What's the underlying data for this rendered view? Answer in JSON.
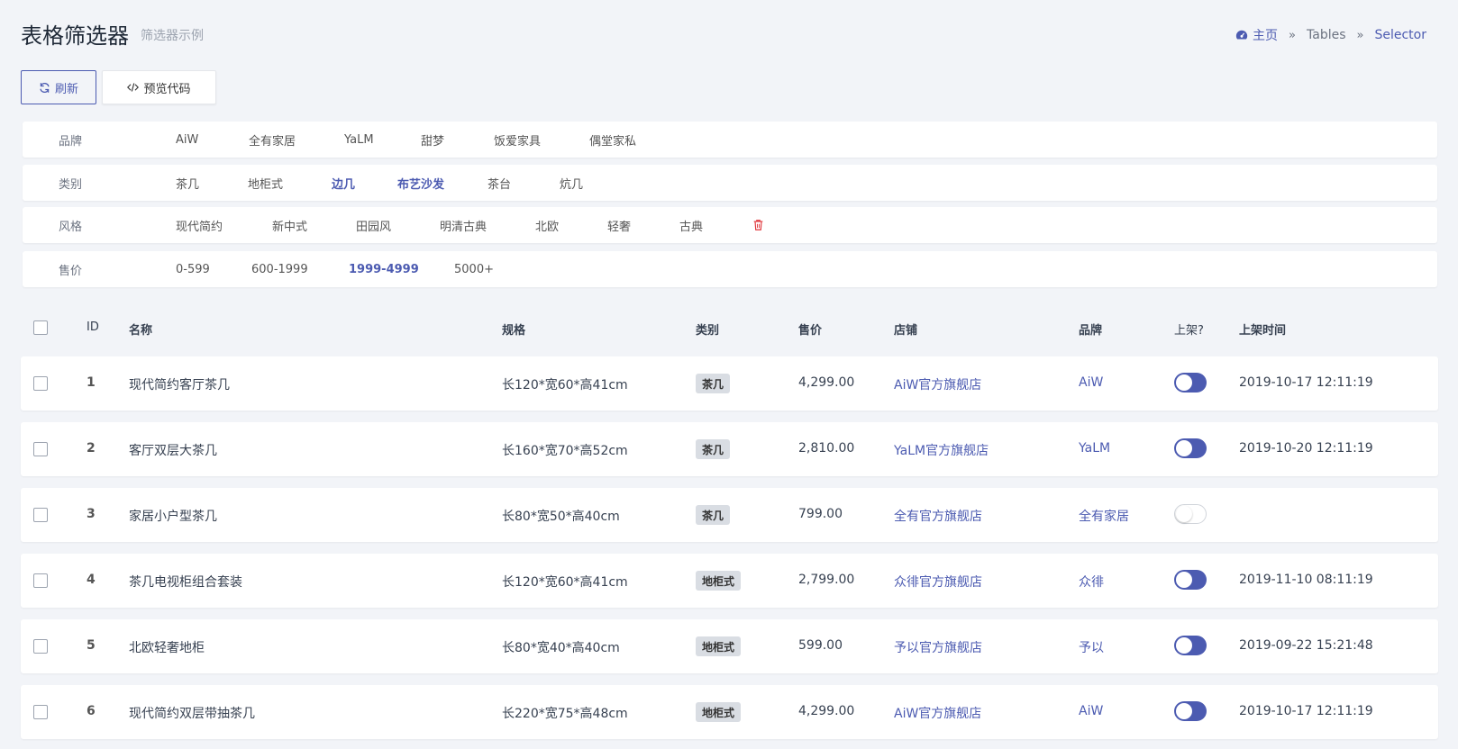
{
  "header": {
    "title": "表格筛选器",
    "subtitle": "筛选器示例",
    "breadcrumb": {
      "home": "主页",
      "middle": "Tables",
      "current": "Selector"
    }
  },
  "toolbar": {
    "refresh_label": "刷新",
    "code_label": "预览代码"
  },
  "filters": {
    "brand": {
      "label": "品牌",
      "options": [
        "AiW",
        "全有家居",
        "YaLM",
        "甜梦",
        "饭爱家具",
        "偶堂家私"
      ]
    },
    "category": {
      "label": "类别",
      "options": [
        "茶几",
        "地柜式",
        "边几",
        "布艺沙发",
        "茶台",
        "炕几"
      ],
      "active": [
        "边几",
        "布艺沙发"
      ]
    },
    "style": {
      "label": "风格",
      "options": [
        "现代简约",
        "新中式",
        "田园风",
        "明清古典",
        "北欧",
        "轻奢",
        "古典"
      ],
      "clear_icon": "trash-icon"
    },
    "price": {
      "label": "售价",
      "options": [
        "0-599",
        "600-1999",
        "1999-4999",
        "5000+"
      ],
      "active": [
        "1999-4999"
      ]
    }
  },
  "table": {
    "columns": [
      "ID",
      "名称",
      "规格",
      "类别",
      "售价",
      "店铺",
      "品牌",
      "上架?",
      "上架时间"
    ],
    "rows": [
      {
        "id": "1",
        "name": "现代简约客厅茶几",
        "spec": "长120*宽60*高41cm",
        "category": "茶几",
        "price": "4,299.00",
        "shop": "AiW官方旗舰店",
        "brand": "AiW",
        "listed": true,
        "time": "2019-10-17 12:11:19"
      },
      {
        "id": "2",
        "name": "客厅双层大茶几",
        "spec": "长160*宽70*高52cm",
        "category": "茶几",
        "price": "2,810.00",
        "shop": "YaLM官方旗舰店",
        "brand": "YaLM",
        "listed": true,
        "time": "2019-10-20 12:11:19"
      },
      {
        "id": "3",
        "name": "家居小户型茶几",
        "spec": "长80*宽50*高40cm",
        "category": "茶几",
        "price": "799.00",
        "shop": "全有官方旗舰店",
        "brand": "全有家居",
        "listed": false,
        "time": ""
      },
      {
        "id": "4",
        "name": "茶几电视柜组合套装",
        "spec": "长120*宽60*高41cm",
        "category": "地柜式",
        "price": "2,799.00",
        "shop": "众徘官方旗舰店",
        "brand": "众徘",
        "listed": true,
        "time": "2019-11-10 08:11:19"
      },
      {
        "id": "5",
        "name": "北欧轻奢地柜",
        "spec": "长80*宽40*高40cm",
        "category": "地柜式",
        "price": "599.00",
        "shop": "予以官方旗舰店",
        "brand": "予以",
        "listed": true,
        "time": "2019-09-22 15:21:48"
      },
      {
        "id": "6",
        "name": "现代简约双层带抽茶几",
        "spec": "长220*宽75*高48cm",
        "category": "地柜式",
        "price": "4,299.00",
        "shop": "AiW官方旗舰店",
        "brand": "AiW",
        "listed": true,
        "time": "2019-10-17 12:11:19"
      }
    ]
  },
  "colors": {
    "accent": "#4c5bb1",
    "danger": "#e0363b"
  }
}
